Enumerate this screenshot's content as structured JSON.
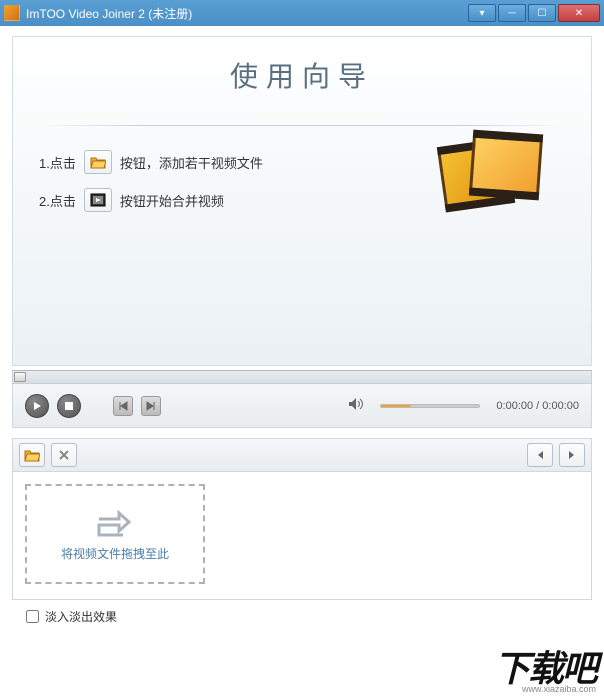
{
  "titlebar": {
    "title": "ImTOO Video Joiner 2 (未注册)"
  },
  "wizard": {
    "heading": "使用向导",
    "step1_prefix": "1.点击",
    "step1_suffix": "按钮，添加若干视频文件",
    "step2_prefix": "2.点击",
    "step2_suffix": "按钮开始合并视频"
  },
  "player": {
    "time_display": "0:00:00 / 0:00:00"
  },
  "dropzone": {
    "text": "将视频文件拖拽至此"
  },
  "footer": {
    "fade_label": "淡入淡出效果"
  },
  "watermark": {
    "logo": "下载吧",
    "url": "www.xiazaiba.com"
  }
}
